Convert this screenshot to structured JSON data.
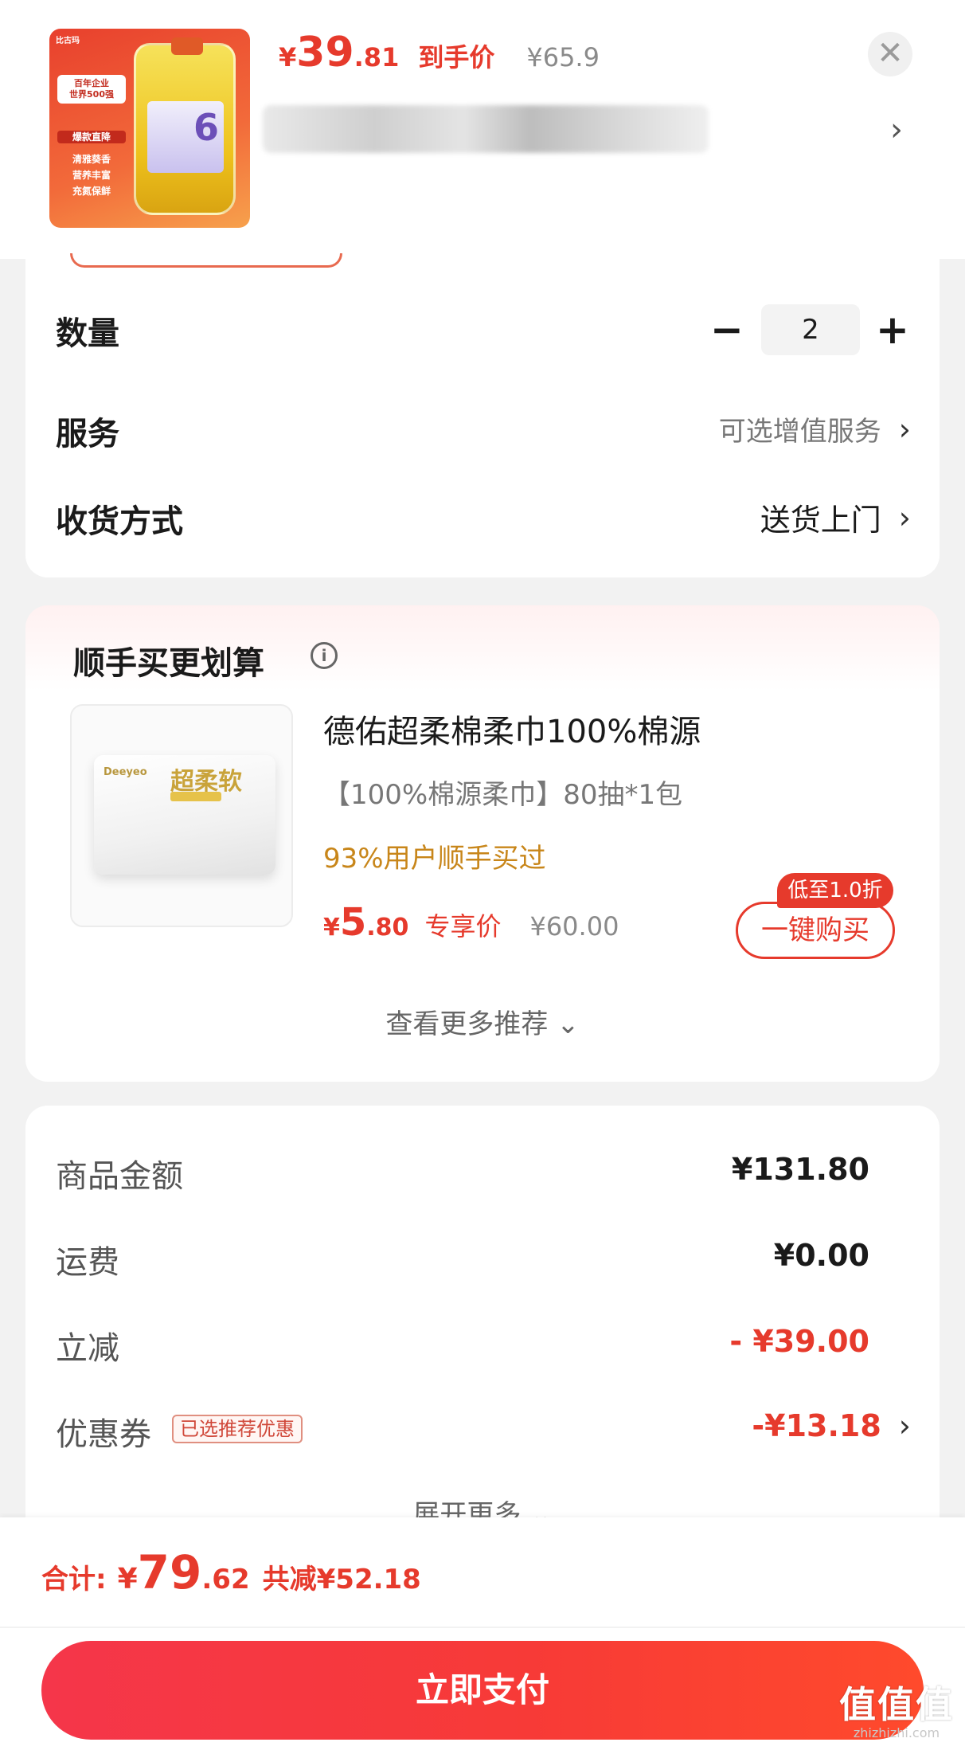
{
  "product": {
    "price_currency": "¥",
    "price_int": "39",
    "price_dec": ".81",
    "price_tag": "到手价",
    "original_price": "¥65.9",
    "thumb_texts": {
      "brand": "比古玛",
      "banner_line1": "百年企业",
      "banner_line2": "世界500强",
      "tag1": "爆款直降",
      "tag2": "清雅葵香",
      "tag3": "营养丰富",
      "tag4": "充氮保鲜",
      "pack_number": "6"
    }
  },
  "options": {
    "quantity_label": "数量",
    "quantity_value": "2",
    "minus_symbol": "−",
    "plus_symbol": "+",
    "service_label": "服务",
    "service_value": "可选增值服务",
    "delivery_label": "收货方式",
    "delivery_value": "送货上门"
  },
  "recommend": {
    "section_title": "顺手买更划算",
    "info_symbol": "i",
    "item_name": "德佑超柔棉柔巾100%棉源",
    "item_spec": "【100%棉源柔巾】80抽*1包",
    "users_bought": "93%用户顺手买过",
    "price_currency": "¥",
    "price_int": "5",
    "price_dec": ".80",
    "price_tag": "专享价",
    "original_price": "¥60.00",
    "discount_badge": "低至1.0折",
    "buy_button": "一键购买",
    "more_link": "查看更多推荐 ⌄",
    "thumb_texts": {
      "brand": "Deeyeo",
      "title": "超柔软"
    }
  },
  "summary": {
    "rows": [
      {
        "label": "商品金额",
        "value": "¥131.80"
      },
      {
        "label": "运费",
        "value": "¥0.00"
      },
      {
        "label": "立减",
        "value": "- ¥39.00"
      },
      {
        "label": "优惠券",
        "value": "-¥13.18"
      }
    ],
    "coupon_chip": "已选推荐优惠",
    "expand_more": "展开更多 ⌄"
  },
  "footer": {
    "total_label": "合计:",
    "total_currency": "¥",
    "total_int": "79",
    "total_dec": ".62",
    "total_saved": "共减¥52.18",
    "pay_button": "立即支付"
  },
  "watermark": {
    "main": "值值值",
    "sub": "zhizhizhi.com"
  },
  "icons": {
    "close": "✕",
    "chevron_right": "›"
  },
  "colors": {
    "accent_red": "#e63a2c",
    "muted_grey": "#777777",
    "highlight_orange": "#c8861a"
  }
}
